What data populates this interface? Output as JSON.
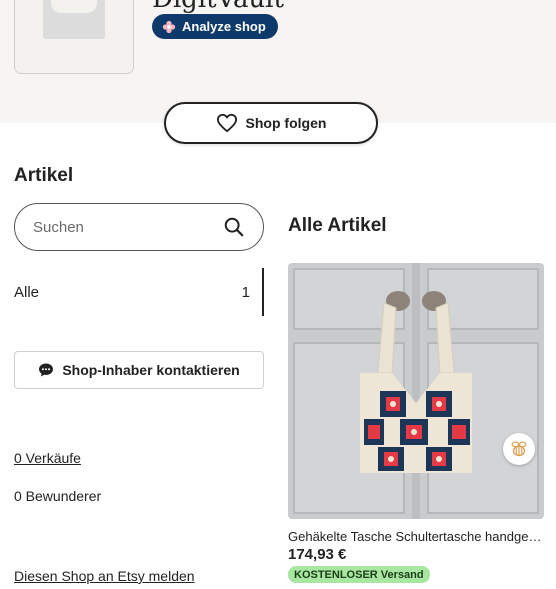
{
  "shop": {
    "name": "DigitVault",
    "analyze_label": "Analyze shop",
    "follow_label": "Shop folgen"
  },
  "sidebar": {
    "title": "Artikel",
    "search_placeholder": "Suchen",
    "category": {
      "label": "Alle",
      "count": "1"
    },
    "contact_label": "Shop-Inhaber kontaktieren",
    "sales_link": "0 Verkäufe",
    "admirers": "0 Bewunderer",
    "report_link": "Diesen Shop an Etsy melden"
  },
  "main": {
    "title": "Alle Artikel",
    "listing": {
      "title": "Gehäkelte Tasche Schultertasche handgemacht",
      "price": "174,93 €",
      "shipping_badge": "KOSTENLOSER Versand"
    }
  },
  "colors": {
    "accent_blue": "#0e3a6b",
    "badge_green": "#a8e6a1"
  },
  "icons": [
    "store-placeholder-icon",
    "flower-icon",
    "heart-icon",
    "search-icon",
    "chat-bubble-icon",
    "bee-icon"
  ]
}
